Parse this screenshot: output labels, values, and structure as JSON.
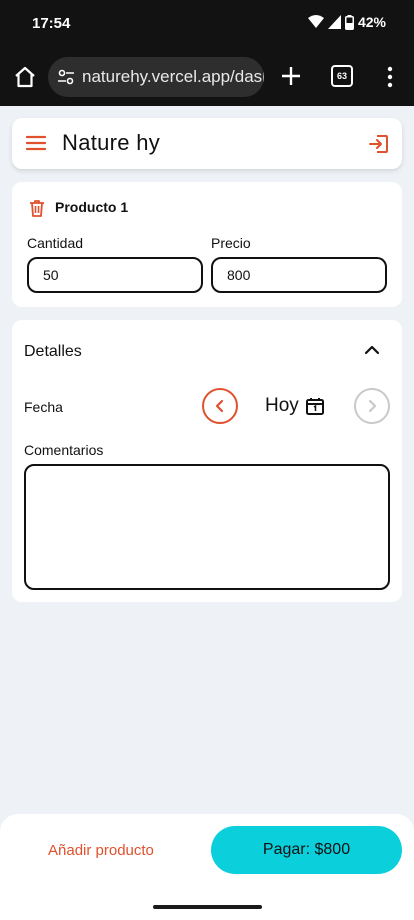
{
  "status_bar": {
    "time": "17:54",
    "battery": "42%"
  },
  "browser": {
    "url": "naturehy.vercel.app/dash",
    "tab_count": "63"
  },
  "header": {
    "title": "Nature hy"
  },
  "product": {
    "name": "Producto 1",
    "quantity_label": "Cantidad",
    "quantity_value": "50",
    "price_label": "Precio",
    "price_value": "800"
  },
  "details": {
    "title": "Detalles",
    "date_label": "Fecha",
    "date_value": "Hoy",
    "comments_label": "Comentarios",
    "comments_value": ""
  },
  "footer": {
    "add_label": "Añadir producto",
    "pay_label": "Pagar: $800"
  },
  "colors": {
    "accent": "#e0512d",
    "pay_button": "#0ccfdc",
    "background": "#eef2f7"
  }
}
